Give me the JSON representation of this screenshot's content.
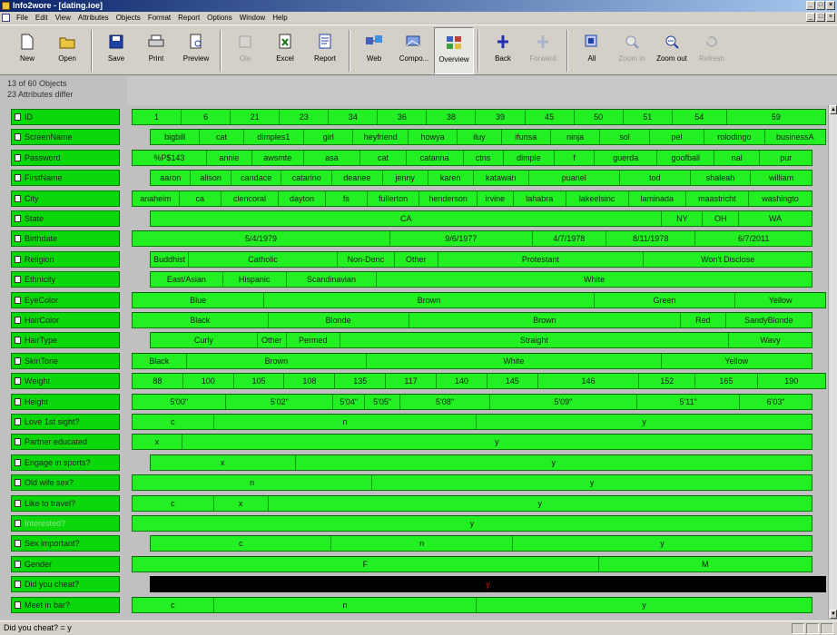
{
  "window": {
    "title": "Info2wore - [dating.ioe]",
    "controls": [
      "_",
      "□",
      "×"
    ]
  },
  "menu": [
    "File",
    "Edit",
    "View",
    "Attributes",
    "Objects",
    "Format",
    "Report",
    "Options",
    "Window",
    "Help"
  ],
  "toolbar": [
    {
      "label": "New",
      "icon": "new-document-icon",
      "enabled": true
    },
    {
      "label": "Open",
      "icon": "open-folder-icon",
      "enabled": true
    },
    {
      "label": "Save",
      "icon": "save-disk-icon",
      "enabled": true
    },
    {
      "label": "Print",
      "icon": "printer-icon",
      "enabled": true
    },
    {
      "label": "Preview",
      "icon": "print-preview-icon",
      "enabled": true
    },
    {
      "label": "Ole",
      "icon": "ole-icon",
      "enabled": false
    },
    {
      "label": "Excel",
      "icon": "excel-icon",
      "enabled": true
    },
    {
      "label": "Report",
      "icon": "report-icon",
      "enabled": true
    },
    {
      "label": "Web",
      "icon": "web-icon",
      "enabled": true
    },
    {
      "label": "Compo...",
      "icon": "compose-icon",
      "enabled": true
    },
    {
      "label": "Overview",
      "icon": "overview-icon",
      "enabled": true,
      "active": true
    },
    {
      "label": "Back",
      "icon": "back-arrow-icon",
      "enabled": true
    },
    {
      "label": "Forward",
      "icon": "forward-arrow-icon",
      "enabled": false
    },
    {
      "label": "All",
      "icon": "all-icon",
      "enabled": true
    },
    {
      "label": "Zoom in",
      "icon": "zoom-in-icon",
      "enabled": false
    },
    {
      "label": "Zoom out",
      "icon": "zoom-out-icon",
      "enabled": true
    },
    {
      "label": "Refresh",
      "icon": "refresh-icon",
      "enabled": false
    }
  ],
  "info": {
    "objects": "13 of 60 Objects",
    "attributes": "23 Attributes differ"
  },
  "rows": [
    {
      "label": "ID",
      "cells": [
        "1",
        "6",
        "21",
        "23",
        "34",
        "36",
        "38",
        "39",
        "45",
        "50",
        "51",
        "54",
        "59"
      ]
    },
    {
      "label": "ScreenName",
      "cells": [
        "bigbill",
        "cat",
        "dimples1",
        "girl",
        "heyfriend",
        "howya",
        "iluy",
        "ifunsa",
        "ninja",
        "sol",
        "pel",
        "rolodingo",
        "businessA"
      ]
    },
    {
      "label": "Password",
      "cells": [
        "%P$143",
        "annie",
        "awsmte",
        "asa",
        "cat",
        "catanna",
        "ctns",
        "dimple",
        "f",
        "guerda",
        "goofball",
        "nal",
        "pur"
      ]
    },
    {
      "label": "FirstName",
      "cells": [
        "aaron",
        "alison",
        "candace",
        "catarino",
        "deanee",
        "jenny",
        "karen",
        "katawan",
        "puanel",
        "tod",
        "shaleah",
        "william"
      ]
    },
    {
      "label": "City",
      "cells": [
        "anaheim",
        "ca",
        "clencoral",
        "dayton",
        "fs",
        "fullerton",
        "henderson",
        "irvine",
        "lahabra",
        "lakeelsinc",
        "laminada",
        "maastricht",
        "washingto"
      ]
    },
    {
      "label": "State",
      "cells": [
        "CA",
        "NY",
        "OH",
        "WA"
      ]
    },
    {
      "label": "Birthdate",
      "cells": [
        "5/4/1979",
        "9/6/1977",
        "4/7/1978",
        "8/11/1978",
        "6/7/2011"
      ]
    },
    {
      "label": "Religion",
      "cells": [
        "Buddhist",
        "Catholic",
        "Non-Denc",
        "Other",
        "Protestant",
        "Won't Disclose"
      ]
    },
    {
      "label": "Ethnicity",
      "cells": [
        "East/Asian",
        "Hispanic",
        "Scandinavian",
        "White"
      ]
    },
    {
      "label": "EyeColor",
      "cells": [
        "Blue",
        "Brown",
        "Green",
        "Yellow"
      ]
    },
    {
      "label": "HairColor",
      "cells": [
        "Black",
        "Blonde",
        "Brown",
        "Red",
        "SandyBlonde"
      ]
    },
    {
      "label": "HairType",
      "cells": [
        "Curly",
        "Other",
        "Permed",
        "Straight",
        "Wavy"
      ]
    },
    {
      "label": "SkinTone",
      "cells": [
        "Black",
        "Brown",
        "White",
        "Yellow"
      ]
    },
    {
      "label": "Weight",
      "cells": [
        "88",
        "100",
        "105",
        "108",
        "135",
        "117",
        "140",
        "145",
        "146",
        "152",
        "165",
        "190"
      ]
    },
    {
      "label": "Height",
      "cells": [
        "5'00\"",
        "5'02\"",
        "5'04\"",
        "5'05\"",
        "5'08\"",
        "5'09\"",
        "5'11\"",
        "6'03\""
      ]
    },
    {
      "label": "Love 1st sight?",
      "cells": [
        "c",
        "n",
        "y"
      ]
    },
    {
      "label": "Partner educated",
      "cells": [
        "x",
        "y"
      ]
    },
    {
      "label": "Engage in sports?",
      "cells": [
        "x",
        "y"
      ]
    },
    {
      "label": "Old wife sex?",
      "cells": [
        "n",
        "y"
      ]
    },
    {
      "label": "Like to travel?",
      "cells": [
        "c",
        "x",
        "y"
      ]
    },
    {
      "label": "Interested?",
      "cells": [
        "y"
      ]
    },
    {
      "label": "Sex important?",
      "cells": [
        "c",
        "n",
        "y"
      ]
    },
    {
      "label": "Gender",
      "cells": [
        "F",
        "M"
      ]
    },
    {
      "label": "Did you cheat?",
      "cells": [
        "y"
      ]
    },
    {
      "label": "Meet in bar?",
      "cells": [
        "c",
        "n",
        "y"
      ]
    }
  ],
  "status": {
    "text": "Did you cheat? = y"
  },
  "colors": {
    "bar_green": "#22f022",
    "label_green": "#0bd80b",
    "dark_bar": "#000000",
    "dark_text": "#c01010"
  }
}
